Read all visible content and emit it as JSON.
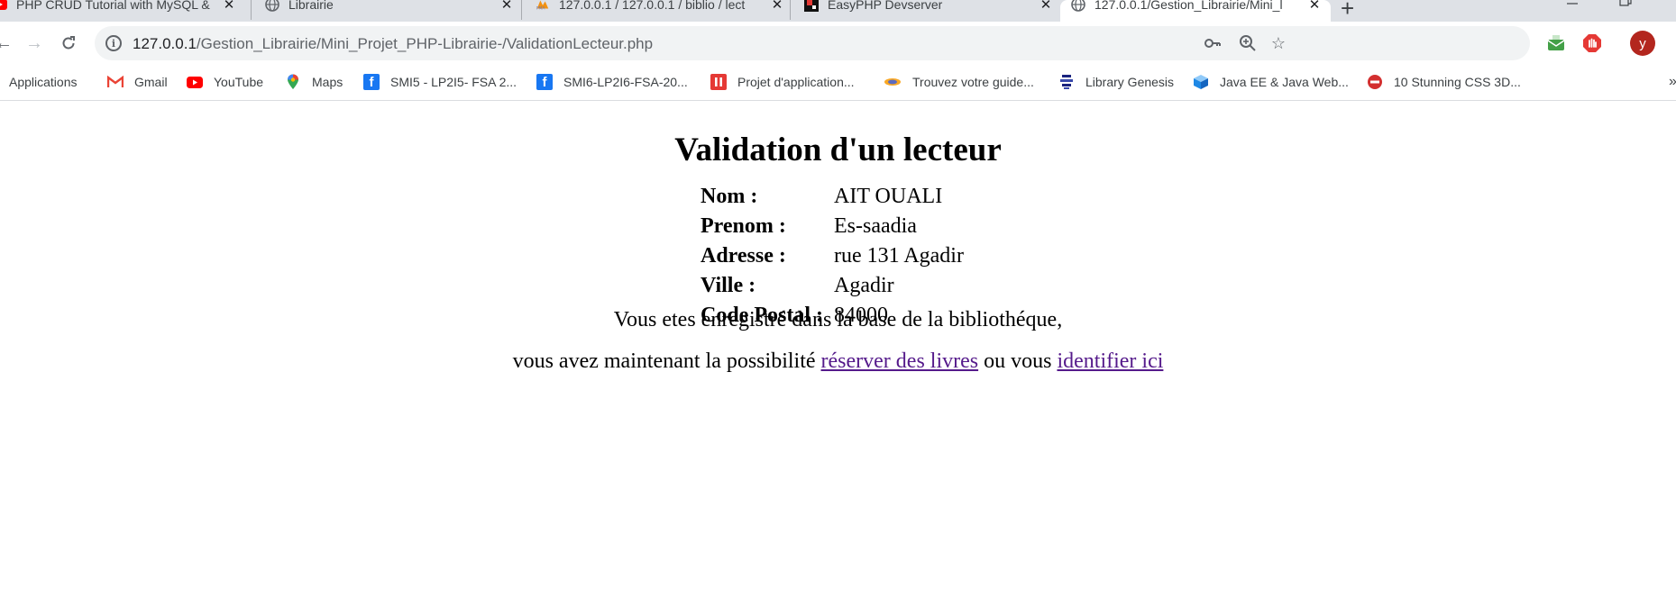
{
  "browser": {
    "tabs": [
      {
        "title": "PHP CRUD Tutorial with MySQL &",
        "icon": "youtube-icon"
      },
      {
        "title": "Librairie",
        "icon": "globe-icon"
      },
      {
        "title": "127.0.0.1 / 127.0.0.1 / biblio / lect",
        "icon": "phpmyadmin-icon"
      },
      {
        "title": "EasyPHP Devserver",
        "icon": "easyphp-icon"
      },
      {
        "title": "127.0.0.1/Gestion_Librairie/Mini_l",
        "icon": "globe-icon",
        "active": true
      }
    ],
    "new_tab_symbol": "+",
    "url": {
      "host": "127.0.0.1",
      "path": "/Gestion_Librairie/Mini_Projet_PHP-Librairie-/ValidationLecteur.php"
    },
    "avatar_letter": "y",
    "bookmarks": [
      {
        "label": "Applications",
        "icon": "apps-grid-icon"
      },
      {
        "label": "Gmail",
        "icon": "gmail-icon"
      },
      {
        "label": "YouTube",
        "icon": "youtube-icon"
      },
      {
        "label": "Maps",
        "icon": "maps-pin-icon"
      },
      {
        "label": "SMI5 - LP2I5- FSA 2...",
        "icon": "facebook-icon"
      },
      {
        "label": "SMI6-LP2I6-FSA-20...",
        "icon": "facebook-icon"
      },
      {
        "label": "Projet d'application...",
        "icon": "pause-icon"
      },
      {
        "label": "Trouvez votre guide...",
        "icon": "guide-icon"
      },
      {
        "label": "Library Genesis",
        "icon": "library-genesis-icon"
      },
      {
        "label": "Java EE & Java Web...",
        "icon": "java-cube-icon"
      },
      {
        "label": "10 Stunning CSS 3D...",
        "icon": "no-entry-icon"
      }
    ],
    "bookmarks_overflow": "»"
  },
  "page": {
    "title": "Validation d'un lecteur",
    "fields": [
      {
        "label": "Nom :",
        "value": "AIT OUALI"
      },
      {
        "label": "Prenom :",
        "value": "Es-saadia"
      },
      {
        "label": "Adresse :",
        "value": "rue 131 Agadir"
      },
      {
        "label": "Ville :",
        "value": "Agadir"
      },
      {
        "label": "Code Postal :",
        "value": "84000"
      }
    ],
    "message_line1": "Vous etes enregistré dans la base de la bibliothéque,",
    "message_line2_prefix": "vous avez maintenant la possibilité ",
    "link_reserve": "réserver des livres",
    "message_line2_middle": " ou vous ",
    "link_identify": "identifier ici"
  },
  "colors": {
    "link_visited": "#551a8b",
    "tabstrip_bg": "#dee1e6",
    "avatar_bg": "#b3261e"
  }
}
